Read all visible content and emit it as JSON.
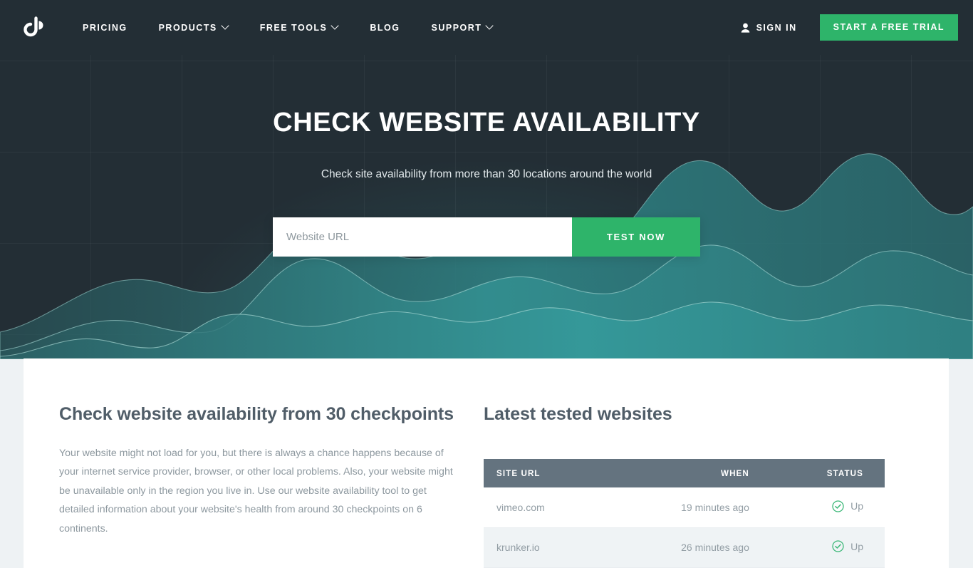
{
  "header": {
    "logo_alt": "JP",
    "nav": [
      {
        "label": "PRICING",
        "has_chevron": false
      },
      {
        "label": "PRODUCTS",
        "has_chevron": true
      },
      {
        "label": "FREE TOOLS",
        "has_chevron": true
      },
      {
        "label": "BLOG",
        "has_chevron": false
      },
      {
        "label": "SUPPORT",
        "has_chevron": true
      }
    ],
    "sign_in_label": "SIGN IN",
    "trial_label": "START A FREE TRIAL"
  },
  "hero": {
    "title": "CHECK WEBSITE AVAILABILITY",
    "subtitle": "Check site availability from more than 30 locations around the world",
    "input_placeholder": "Website URL",
    "input_value": "",
    "button_label": "TEST NOW"
  },
  "left_column": {
    "heading": "Check website availability from 30 checkpoints",
    "paragraph": "Your website might not load for you, but there is always a chance happens because of your internet service provider, browser, or other local problems. Also, your website might be unavailable only in the region you live in. Use our website availability tool to get detailed information about your website's health from around 30 checkpoints on 6 continents."
  },
  "right_column": {
    "heading": "Latest tested websites",
    "table": {
      "columns": [
        "SITE URL",
        "WHEN",
        "STATUS"
      ],
      "rows": [
        {
          "site_url": "vimeo.com",
          "when": "19 minutes ago",
          "status": "Up"
        },
        {
          "site_url": "krunker.io",
          "when": "26 minutes ago",
          "status": "Up"
        }
      ]
    }
  },
  "colors": {
    "header_bg": "#232e35",
    "accent_green": "#2eb46a",
    "table_header_bg": "#64737f",
    "heading_text": "#505d68",
    "body_text": "#8d989f",
    "status_up": "#3cb878",
    "page_bg": "#eef2f4",
    "hero_wave": "#2f7f80"
  }
}
